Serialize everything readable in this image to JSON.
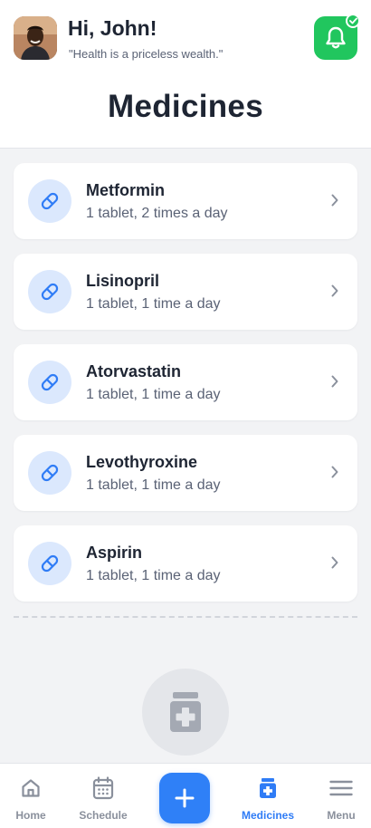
{
  "header": {
    "greeting": "Hi, John!",
    "quote": "\"Health is a priceless wealth.\"",
    "page_title": "Medicines",
    "avatar_icon": "user-avatar",
    "notification_icon": "bell-icon",
    "notification_badge_icon": "check-icon",
    "accent_color": "#21c65e"
  },
  "medicines": [
    {
      "name": "Metformin",
      "dosage": "1 tablet, 2 times a day",
      "icon": "pill-icon"
    },
    {
      "name": "Lisinopril",
      "dosage": "1 tablet, 1 time a day",
      "icon": "pill-icon"
    },
    {
      "name": "Atorvastatin",
      "dosage": "1 tablet, 1 time a day",
      "icon": "pill-icon"
    },
    {
      "name": "Levothyroxine",
      "dosage": "1 tablet, 1 time a day",
      "icon": "pill-icon"
    },
    {
      "name": "Aspirin",
      "dosage": "1 tablet, 1 time a day",
      "icon": "pill-icon"
    }
  ],
  "empty_state": {
    "icon": "medicine-jar-icon"
  },
  "nav": {
    "home": "Home",
    "schedule": "Schedule",
    "add_icon": "plus-icon",
    "medicines": "Medicines",
    "menu": "Menu",
    "active": "Medicines",
    "active_color": "#2f7cf6"
  }
}
